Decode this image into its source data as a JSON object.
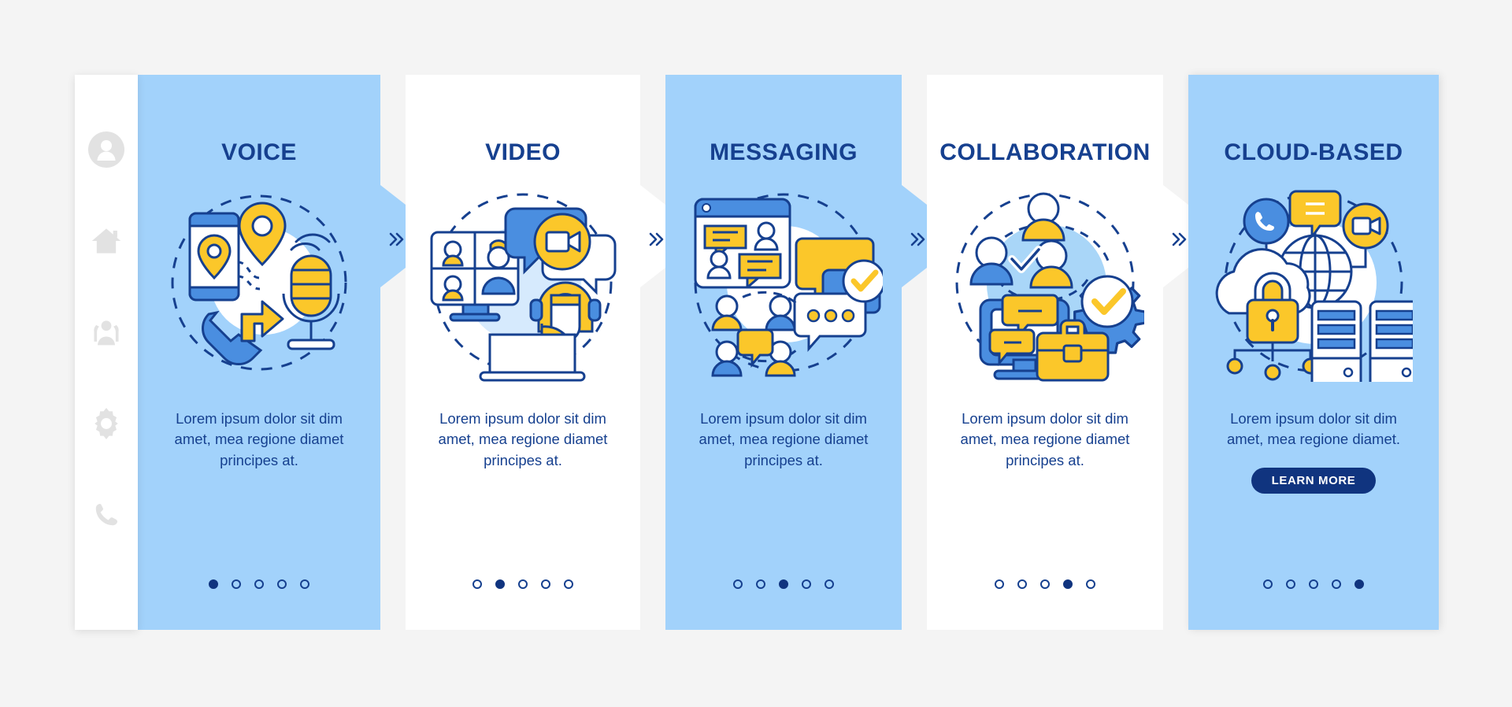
{
  "theme": {
    "page_background": "#f4f4f4",
    "panel_blue": "#a2d2fb",
    "panel_white": "#ffffff",
    "text_navy": "#16408f",
    "button_navy": "#10347f",
    "accent_yellow": "#fbc72a",
    "accent_blue": "#4a8ee0",
    "sidebar_icon_grey": "#e2e2e2"
  },
  "sidebar": {
    "items": [
      {
        "icon": "user-avatar-icon",
        "label": "Account"
      },
      {
        "icon": "home-icon",
        "label": "Home"
      },
      {
        "icon": "people-group-icon",
        "label": "Contacts"
      },
      {
        "icon": "gear-icon",
        "label": "Settings"
      },
      {
        "icon": "phone-icon",
        "label": "Calls"
      }
    ]
  },
  "separator": {
    "glyph": "»",
    "name": "chevron-double-right-icon"
  },
  "panels": [
    {
      "id": "voice",
      "title": "VOICE",
      "theme": "blue",
      "illustration": "voice-illustration",
      "body": "Lorem ipsum dolor sit dim amet, mea regione diamet principes at.",
      "active_dot": 1,
      "dot_count": 5,
      "cta": null
    },
    {
      "id": "video",
      "title": "VIDEO",
      "theme": "white",
      "illustration": "video-illustration",
      "body": "Lorem ipsum dolor sit dim amet, mea regione diamet principes at.",
      "active_dot": 2,
      "dot_count": 5,
      "cta": null
    },
    {
      "id": "messaging",
      "title": "MESSAGING",
      "theme": "blue",
      "illustration": "messaging-illustration",
      "body": "Lorem ipsum dolor sit dim amet, mea regione diamet principes at.",
      "active_dot": 3,
      "dot_count": 5,
      "cta": null
    },
    {
      "id": "collaboration",
      "title": "COLLABORATION",
      "theme": "white",
      "illustration": "collaboration-illustration",
      "body": "Lorem ipsum dolor sit dim amet, mea regione diamet principes at.",
      "active_dot": 4,
      "dot_count": 5,
      "cta": null
    },
    {
      "id": "cloud-based",
      "title": "CLOUD-BASED",
      "theme": "blue",
      "illustration": "cloud-based-illustration",
      "body": "Lorem ipsum dolor sit dim amet, mea regione diamet.",
      "active_dot": 5,
      "dot_count": 5,
      "cta": "LEARN MORE"
    }
  ]
}
